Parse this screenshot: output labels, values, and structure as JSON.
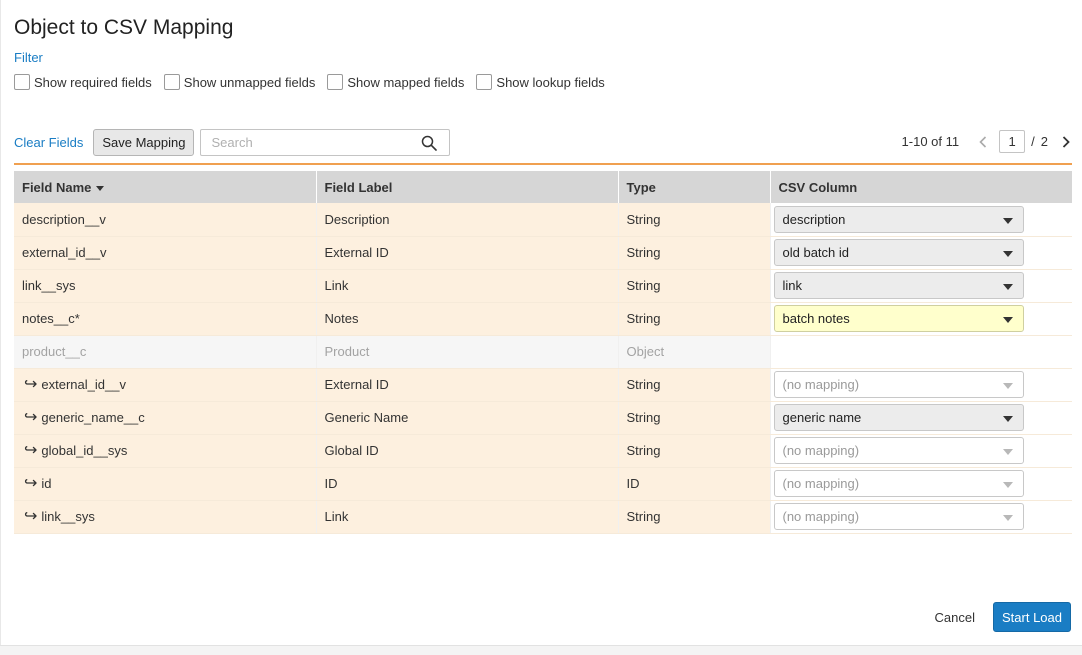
{
  "dialog": {
    "title": "Object to CSV Mapping",
    "filter_label": "Filter",
    "filters": [
      {
        "label": "Show required fields",
        "checked": false
      },
      {
        "label": "Show unmapped fields",
        "checked": false
      },
      {
        "label": "Show mapped fields",
        "checked": false
      },
      {
        "label": "Show lookup fields",
        "checked": false
      }
    ]
  },
  "toolbar": {
    "clear_label": "Clear Fields",
    "save_label": "Save Mapping",
    "search_placeholder": "Search",
    "search_value": ""
  },
  "pager": {
    "range": "1-10 of 11",
    "current_page": "1",
    "separator": "/",
    "total_pages": "2"
  },
  "table": {
    "headers": {
      "field_name": "Field Name",
      "field_label": "Field Label",
      "type": "Type",
      "csv_column": "CSV Column"
    },
    "rows": [
      {
        "name": "description__v",
        "label": "Description",
        "type": "String",
        "csv": "description"
      },
      {
        "name": "external_id__v",
        "label": "External ID",
        "type": "String",
        "csv": "old batch id"
      },
      {
        "name": "link__sys",
        "label": "Link",
        "type": "String",
        "csv": "link"
      },
      {
        "name": "notes__c*",
        "label": "Notes",
        "type": "String",
        "csv": "batch notes"
      },
      {
        "name": "product__c",
        "label": "Product",
        "type": "Object",
        "csv": ""
      },
      {
        "name": "external_id__v",
        "label": "External ID",
        "type": "String",
        "csv": "(no mapping)"
      },
      {
        "name": "generic_name__c",
        "label": "Generic Name",
        "type": "String",
        "csv": "generic name"
      },
      {
        "name": "global_id__sys",
        "label": "Global ID",
        "type": "String",
        "csv": "(no mapping)"
      },
      {
        "name": "id",
        "label": "ID",
        "type": "ID",
        "csv": "(no mapping)"
      },
      {
        "name": "link__sys",
        "label": "Link",
        "type": "String",
        "csv": "(no mapping)"
      }
    ]
  },
  "footer": {
    "cancel_label": "Cancel",
    "start_label": "Start Load"
  },
  "colors": {
    "accent": "#1a7dc4",
    "row_bg": "#fdf0df",
    "highlight": "#ffffcc",
    "divider": "#f0a050"
  },
  "icons": {
    "search": "search-icon",
    "prev": "chevron-left-icon",
    "next": "chevron-right-icon",
    "child": "child-arrow-icon",
    "dropdown": "chevron-down-icon"
  }
}
